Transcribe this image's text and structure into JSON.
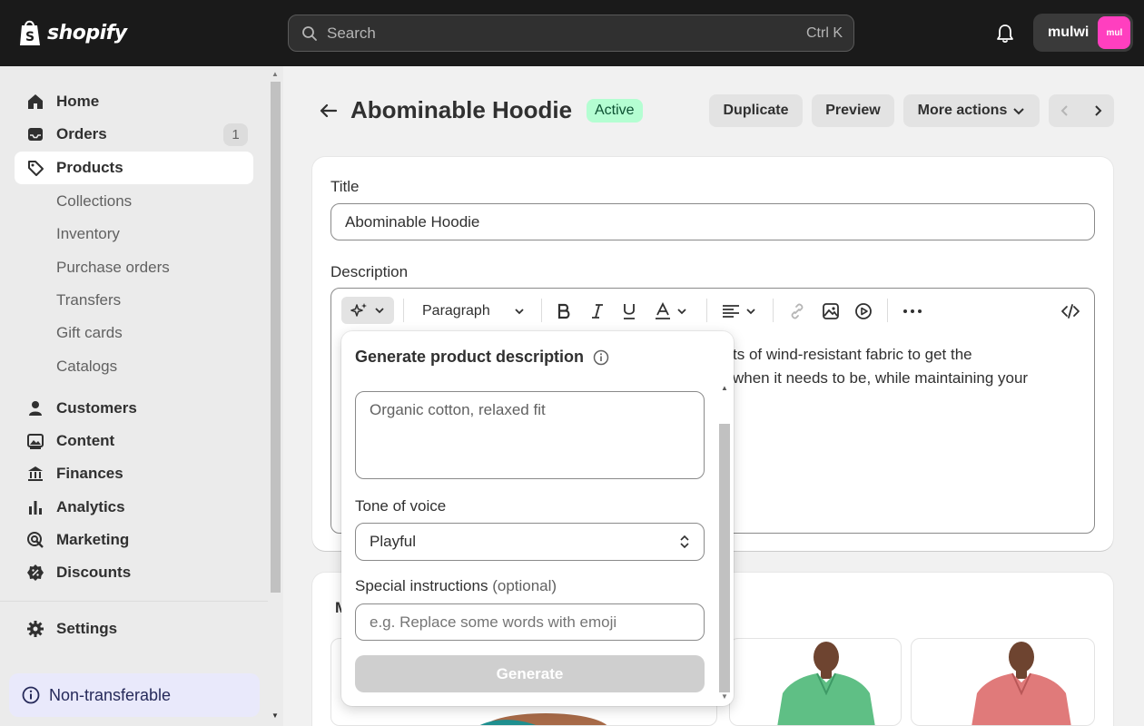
{
  "topbar": {
    "logo_text": "shopify",
    "search_placeholder": "Search",
    "search_shortcut": "Ctrl K",
    "account_name": "mulwi",
    "avatar_initials": "mul",
    "avatar_color": "#ff3fbf"
  },
  "sidebar": {
    "items": [
      {
        "label": "Home",
        "icon": "home-icon"
      },
      {
        "label": "Orders",
        "icon": "inbox-icon",
        "badge": "1"
      },
      {
        "label": "Products",
        "icon": "tag-icon"
      },
      {
        "label": "Customers",
        "icon": "person-icon"
      },
      {
        "label": "Content",
        "icon": "image-icon"
      },
      {
        "label": "Finances",
        "icon": "bank-icon"
      },
      {
        "label": "Analytics",
        "icon": "bar-chart-icon"
      },
      {
        "label": "Marketing",
        "icon": "target-icon"
      },
      {
        "label": "Discounts",
        "icon": "discount-icon"
      },
      {
        "label": "Settings",
        "icon": "gear-icon"
      }
    ],
    "products_subitems": [
      "Collections",
      "Inventory",
      "Purchase orders",
      "Transfers",
      "Gift cards",
      "Catalogs"
    ],
    "notice": "Non-transferable"
  },
  "header": {
    "title": "Abominable Hoodie",
    "status": "Active",
    "duplicate": "Duplicate",
    "preview": "Preview",
    "more_actions": "More actions"
  },
  "form": {
    "title_label": "Title",
    "title_value": "Abominable Hoodie",
    "description_label": "Description",
    "paragraph_select": "Paragraph",
    "description_line1": "ts of wind-resistant fabric to get the",
    "description_line2": "when it needs to be, while maintaining your",
    "media_label_partial": "M"
  },
  "generator": {
    "title": "Generate product description",
    "features_placeholder": "Organic cotton, relaxed fit",
    "tone_label": "Tone of voice",
    "tone_value": "Playful",
    "instructions_label": "Special instructions",
    "instructions_optional": "(optional)",
    "instructions_placeholder": "e.g. Replace some words with emoji",
    "generate_button": "Generate"
  },
  "colors": {
    "status_bg": "#b4fed2",
    "status_text": "#0c5132",
    "topbar": "#1a1a1a"
  }
}
